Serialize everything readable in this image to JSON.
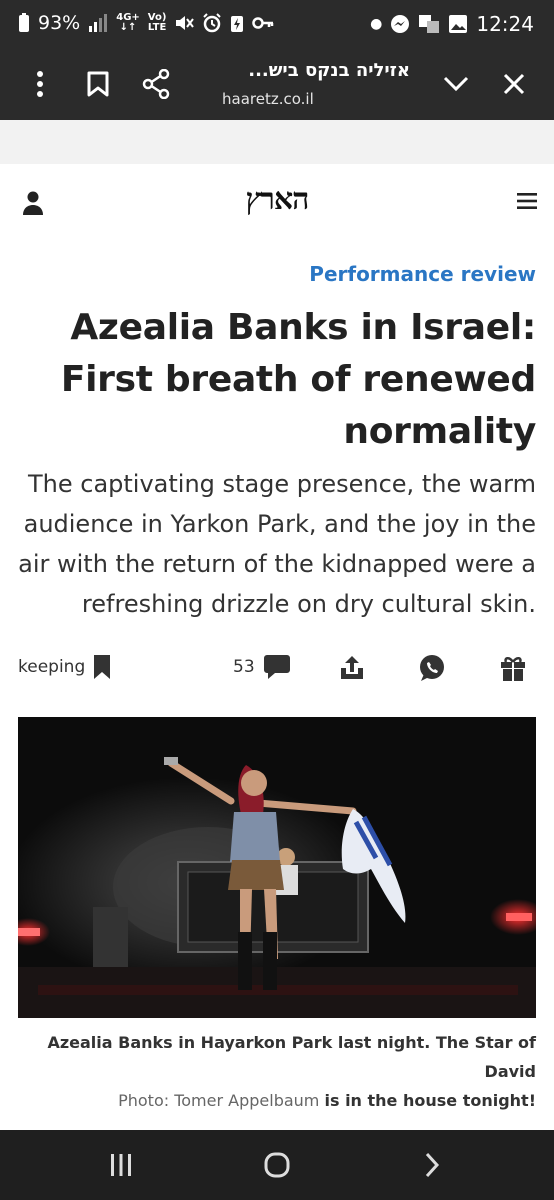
{
  "status_bar": {
    "battery": "93%",
    "network_top": "4G+",
    "volte_top": "Vo)",
    "volte_bottom": "LTE",
    "time": "12:24"
  },
  "browser": {
    "tab_title": "אזיליה בנקס ביש...",
    "url": "haaretz.co.il"
  },
  "site": {
    "logo": "הארץ"
  },
  "article": {
    "kicker": "Performance review",
    "headline": "Azealia Banks in Israel: First breath of renewed normality",
    "subhead": "The captivating stage presence, the warm audience in Yarkon Park, and the joy in the air with the return of the kidnapped were a refreshing drizzle on dry cultural skin."
  },
  "toolbar": {
    "save_label": "keeping",
    "comments_count": "53"
  },
  "photo": {
    "caption_line1": "Azealia Banks in Hayarkon Park last night. The Star of David",
    "credit": "Photo: Tomer Appelbaum",
    "caption_line2": "is in the house tonight!"
  },
  "icons": {
    "status": [
      "battery-icon",
      "signal-icon",
      "mute-icon",
      "alarm-icon",
      "key-icon",
      "messenger-icon",
      "gallery-icon"
    ],
    "browser": [
      "more-icon",
      "bookmark-icon",
      "share-icon",
      "chevron-down-icon",
      "close-icon"
    ],
    "toolbar": [
      "bookmark-icon",
      "comment-icon",
      "share-icon",
      "whatsapp-icon",
      "gift-icon"
    ],
    "nav": [
      "recent-apps-icon",
      "home-icon",
      "back-icon"
    ]
  },
  "colors": {
    "kicker": "#2a76c4",
    "chrome_bg": "#2b2b2b",
    "nav_bg": "#1f1f1f"
  }
}
